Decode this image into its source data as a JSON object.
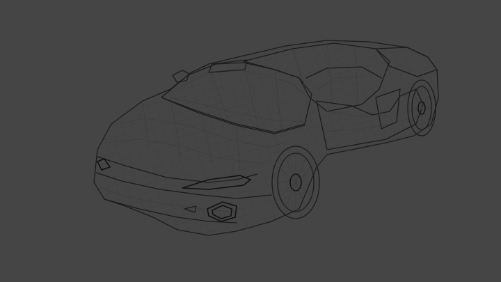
{
  "viewport": {
    "background": "#454545",
    "mesh_fill": "#e8ecec",
    "shadow_fill": "#c9cfd0",
    "wire_color": "#1c1c1c"
  },
  "subject": "wireframe-car-model"
}
